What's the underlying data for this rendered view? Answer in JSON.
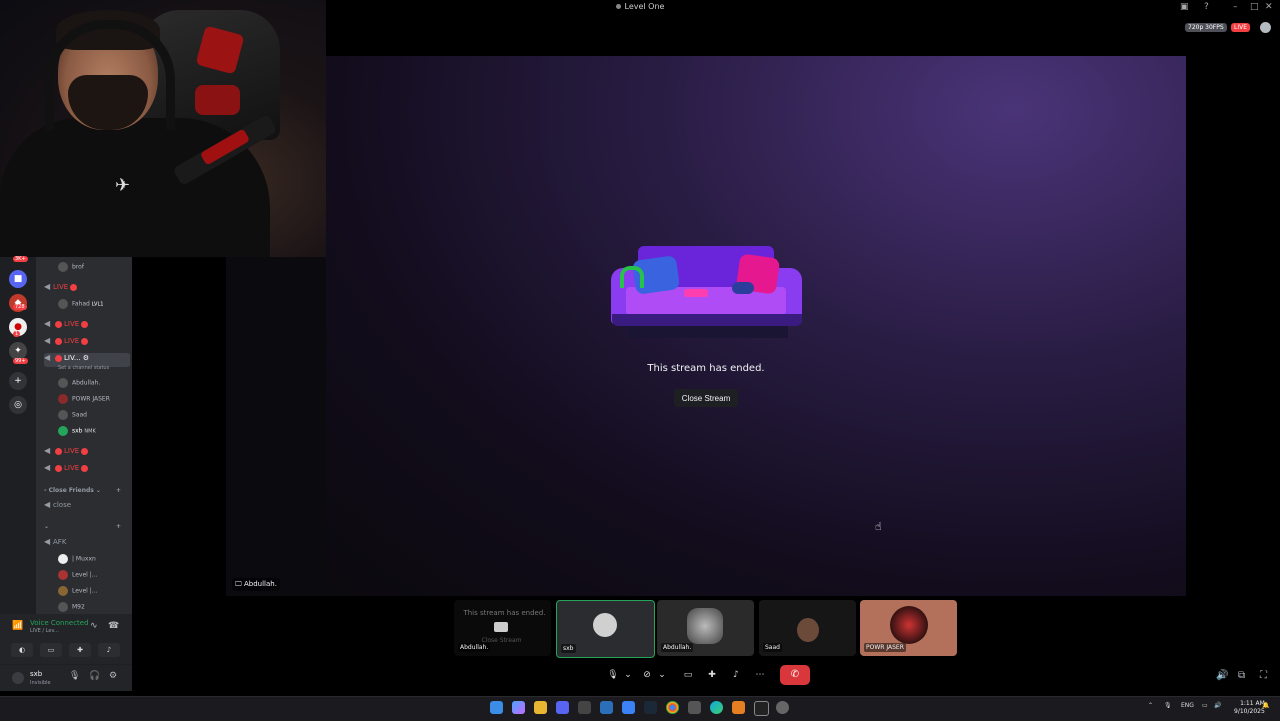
{
  "window": {
    "title": "Level One"
  },
  "stream_overlay": {
    "quality": "720p 30FPS",
    "live": "LIVE"
  },
  "stage": {
    "ended_message": "This stream has ended.",
    "close_button": "Close Stream",
    "streamer_label": "Abdullah."
  },
  "sidebar": {
    "rows": [
      {
        "name": "brof",
        "type": "user"
      },
      {
        "name": "LIVE",
        "type": "live-channel"
      },
      {
        "name": "Fahad",
        "badge": "LVL1",
        "type": "user"
      },
      {
        "name": "LIVE",
        "type": "live-channel"
      },
      {
        "name": "LIVE",
        "type": "live-channel"
      },
      {
        "name": "LIV...",
        "type": "live-channel-active",
        "status": "Set a channel status"
      },
      {
        "name": "Abdullah.",
        "type": "user"
      },
      {
        "name": "POWR JASER",
        "type": "user"
      },
      {
        "name": "Saad",
        "type": "user"
      },
      {
        "name": "sxb",
        "badge": "NMK",
        "type": "user"
      },
      {
        "name": "LIVE",
        "type": "live-channel"
      },
      {
        "name": "LIVE",
        "type": "live-channel"
      }
    ],
    "category_close_friends": "Close Friends",
    "channel_close": "close",
    "channel_afk": "AFK",
    "afk_users": [
      "| Muxxn",
      "Level |...",
      "Level |...",
      "M92"
    ]
  },
  "voice_panel": {
    "status": "Voice Connected",
    "channel": "LIVE / Lev..."
  },
  "user_panel": {
    "name": "sxb",
    "status": "Invisible"
  },
  "tiles": [
    {
      "label": "Abdullah.",
      "message": "This stream has ended.",
      "close": "Close Stream"
    },
    {
      "label": "sxb"
    },
    {
      "label": "Abdullah."
    },
    {
      "label": "Saad"
    },
    {
      "label": "POWR JASER"
    }
  ],
  "rail": {
    "badges": [
      "3K+",
      "728",
      "1",
      "99+"
    ]
  },
  "taskbar": {
    "lang": "ENG",
    "time": "1:11 AM",
    "date": "9/10/2025"
  },
  "colors": {
    "live_red": "#f23f43",
    "connected_green": "#23a55a",
    "hangup_red": "#da373c"
  }
}
